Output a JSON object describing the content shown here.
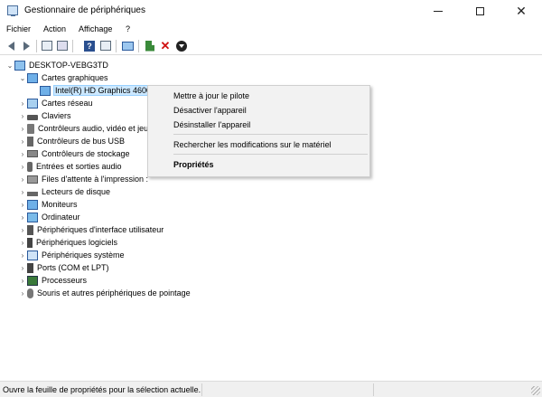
{
  "window": {
    "title": "Gestionnaire de périphériques"
  },
  "menu": {
    "items": [
      "Fichier",
      "Action",
      "Affichage",
      "?"
    ]
  },
  "toolbar": {
    "buttons": [
      "back-icon",
      "forward-icon",
      "properties-icon",
      "refresh-icon",
      "help-icon",
      "view-icon",
      "scan-monitor-icon",
      "update-driver-icon",
      "uninstall-icon",
      "disable-icon"
    ]
  },
  "tree": {
    "root": "DESKTOP-VEBG3TD",
    "categories": [
      {
        "label": "Cartes graphiques",
        "expanded": true,
        "icon": "display-adapter-icon"
      },
      {
        "label": "Intel(R) HD Graphics 4600",
        "child": true,
        "icon": "display-icon"
      },
      {
        "label": "Cartes réseau",
        "icon": "network-adapter-icon"
      },
      {
        "label": "Claviers",
        "icon": "keyboard-icon"
      },
      {
        "label": "Contrôleurs audio, vidéo et jeu",
        "icon": "speaker-icon"
      },
      {
        "label": "Contrôleurs de bus USB",
        "icon": "usb-icon"
      },
      {
        "label": "Contrôleurs de stockage",
        "icon": "storage-icon"
      },
      {
        "label": "Entrées et sorties audio",
        "icon": "audio-io-icon"
      },
      {
        "label": "Files d'attente à l'impression :",
        "icon": "printer-icon"
      },
      {
        "label": "Lecteurs de disque",
        "icon": "disk-drive-icon"
      },
      {
        "label": "Moniteurs",
        "icon": "monitor-icon"
      },
      {
        "label": "Ordinateur",
        "icon": "computer-icon"
      },
      {
        "label": "Périphériques d'interface utilisateur",
        "icon": "hid-icon"
      },
      {
        "label": "Périphériques logiciels",
        "icon": "software-device-icon"
      },
      {
        "label": "Périphériques système",
        "icon": "system-device-icon"
      },
      {
        "label": "Ports (COM et LPT)",
        "icon": "port-icon"
      },
      {
        "label": "Processeurs",
        "icon": "processor-icon"
      },
      {
        "label": "Souris et autres périphériques de pointage",
        "icon": "mouse-icon"
      }
    ]
  },
  "context_menu": {
    "update_driver": "Mettre à jour le pilote",
    "disable": "Désactiver l'appareil",
    "uninstall": "Désinstaller l'appareil",
    "scan": "Rechercher les modifications sur le matériel",
    "properties": "Propriétés"
  },
  "status": {
    "text": "Ouvre la feuille de propriétés pour la sélection actuelle."
  }
}
